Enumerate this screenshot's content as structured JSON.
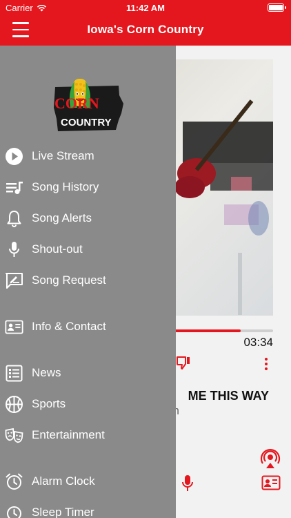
{
  "status_bar": {
    "carrier": "Carrier",
    "time": "11:42 AM"
  },
  "nav": {
    "title": "Iowa's Corn Country"
  },
  "logo": {
    "line1": "CORN",
    "line2": "COUNTRY"
  },
  "drawer": {
    "items": [
      {
        "label": "Live Stream",
        "icon": "play-circle-icon"
      },
      {
        "label": "Song History",
        "icon": "song-history-icon"
      },
      {
        "label": "Song Alerts",
        "icon": "bell-icon"
      },
      {
        "label": "Shout-out",
        "icon": "microphone-icon"
      },
      {
        "label": "Song Request",
        "icon": "song-request-icon"
      },
      {
        "label": "Info & Contact",
        "icon": "contact-card-icon"
      },
      {
        "label": "News",
        "icon": "news-icon"
      },
      {
        "label": "Sports",
        "icon": "sports-ball-icon"
      },
      {
        "label": "Entertainment",
        "icon": "theater-masks-icon"
      },
      {
        "label": "Alarm Clock",
        "icon": "alarm-clock-icon"
      },
      {
        "label": "Sleep Timer",
        "icon": "sleep-timer-icon"
      }
    ]
  },
  "player": {
    "total_time": "03:34",
    "progress": 0.87,
    "song_title": "ME THIS WAY",
    "song_artist": "n"
  },
  "colors": {
    "accent": "#e5171e",
    "drawer_bg": "#8a8a8a"
  }
}
